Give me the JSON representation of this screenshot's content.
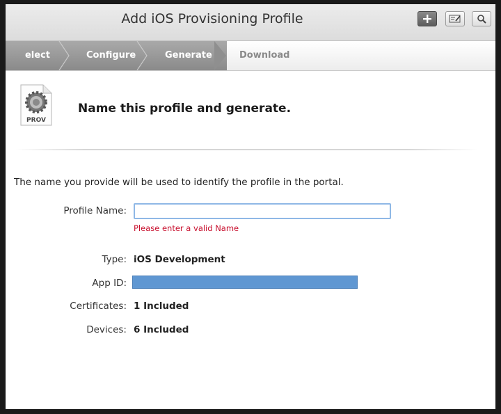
{
  "header": {
    "title": "Add iOS Provisioning Profile",
    "buttons": [
      {
        "name": "add-button",
        "icon": "plus-icon"
      },
      {
        "name": "edit-button",
        "icon": "edit-icon"
      },
      {
        "name": "search-button",
        "icon": "search-icon"
      }
    ]
  },
  "steps": [
    {
      "label": "elect Type",
      "state": "done"
    },
    {
      "label": "Configure",
      "state": "done"
    },
    {
      "label": "Generate",
      "state": "current"
    },
    {
      "label": "Download",
      "state": "future"
    }
  ],
  "page": {
    "file_icon_label": "PROV",
    "heading": "Name this profile and generate.",
    "intro": "The name you provide will be used to identify the profile in the portal."
  },
  "form": {
    "profile_name_label": "Profile Name:",
    "profile_name_value": "",
    "error": "Please enter a valid Name",
    "type_label": "Type:",
    "type_value": "iOS Development",
    "app_id_label": "App ID:",
    "certificates_label": "Certificates:",
    "certificates_value": "1 Included",
    "devices_label": "Devices:",
    "devices_value": "6 Included"
  },
  "colors": {
    "error": "#c8102e",
    "redaction": "#5f97d2",
    "step_active": "#8a8a8a"
  }
}
